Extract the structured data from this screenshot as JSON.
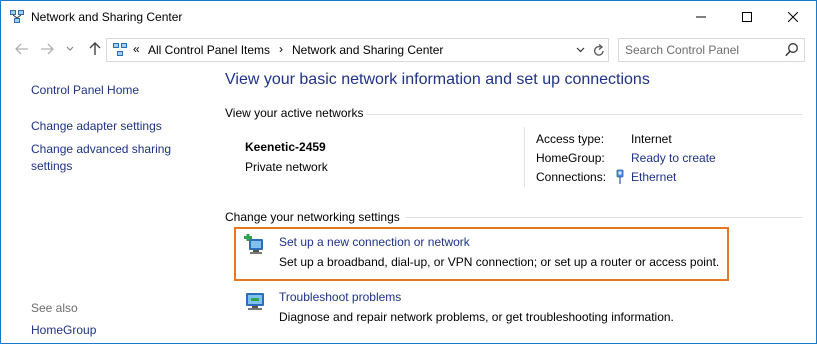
{
  "window": {
    "title": "Network and Sharing Center"
  },
  "address": {
    "chevron": "«",
    "crumbs": [
      "All Control Panel Items",
      "Network and Sharing Center"
    ],
    "separator": "›"
  },
  "search": {
    "placeholder": "Search Control Panel"
  },
  "sidebar": {
    "links": [
      "Control Panel Home",
      "Change adapter settings",
      "Change advanced sharing settings"
    ],
    "see_also_label": "See also",
    "see_also_links": [
      "HomeGroup"
    ]
  },
  "main": {
    "title": "View your basic network information and set up connections",
    "active_networks_header": "View your active networks",
    "network": {
      "name": "Keenetic-2459",
      "type": "Private network",
      "access_type_label": "Access type:",
      "access_type_value": "Internet",
      "homegroup_label": "HomeGroup:",
      "homegroup_value": "Ready to create",
      "connections_label": "Connections:",
      "connections_value": "Ethernet"
    },
    "change_settings_header": "Change your networking settings",
    "tasks": [
      {
        "title": "Set up a new connection or network",
        "desc": "Set up a broadband, dial-up, or VPN connection; or set up a router or access point."
      },
      {
        "title": "Troubleshoot problems",
        "desc": "Diagnose and repair network problems, or get troubleshooting information."
      }
    ]
  },
  "colors": {
    "link": "#1e3287",
    "highlight": "#e87722",
    "border": "#1979ca"
  },
  "icons": [
    "network-center-icon",
    "minimize-icon",
    "maximize-icon",
    "close-icon",
    "back-arrow-icon",
    "forward-arrow-icon",
    "recent-pages-chevron-icon",
    "up-arrow-icon",
    "address-dropdown-icon",
    "refresh-icon",
    "search-icon",
    "ethernet-icon",
    "new-connection-icon",
    "troubleshoot-icon"
  ]
}
